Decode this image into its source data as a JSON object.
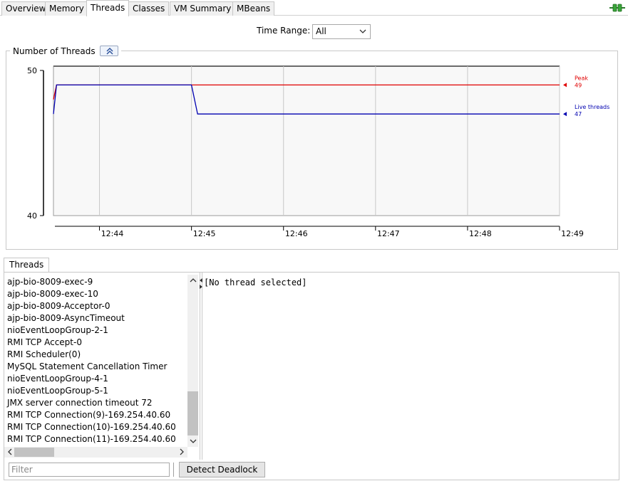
{
  "tabs": [
    {
      "label": "Overview"
    },
    {
      "label": "Memory"
    },
    {
      "label": "Threads",
      "active": true
    },
    {
      "label": "Classes"
    },
    {
      "label": "VM Summary"
    },
    {
      "label": "MBeans"
    }
  ],
  "icons": {
    "connection": "connection-plug-icon",
    "collapse": "collapse-up-icon",
    "dropdown": "chevron-down-icon"
  },
  "time_range": {
    "label": "Time Range:",
    "selected": "All"
  },
  "chart_panel": {
    "title": "Number of Threads"
  },
  "chart_data": {
    "type": "line",
    "ylim": [
      40,
      50
    ],
    "y_ticks": [
      "50",
      "40"
    ],
    "x_ticks": [
      "12:44",
      "12:45",
      "12:46",
      "12:47",
      "12:48",
      "12:49"
    ],
    "series": [
      {
        "name": "Peak",
        "current_value": "49",
        "color": "#e00000",
        "points": [
          [
            "12:43:30",
            48
          ],
          [
            "12:43:32",
            49
          ],
          [
            "12:49:00",
            49
          ]
        ]
      },
      {
        "name": "Live threads",
        "current_value": "47",
        "color": "#0000b0",
        "points": [
          [
            "12:43:30",
            47
          ],
          [
            "12:43:32",
            49
          ],
          [
            "12:45:00",
            49
          ],
          [
            "12:45:04",
            47
          ],
          [
            "12:49:00",
            47
          ]
        ]
      }
    ]
  },
  "threads_panel": {
    "tab_label": "Threads",
    "items": [
      "ajp-bio-8009-exec-9",
      "ajp-bio-8009-exec-10",
      "ajp-bio-8009-Acceptor-0",
      "ajp-bio-8009-AsyncTimeout",
      "nioEventLoopGroup-2-1",
      "RMI TCP Accept-0",
      "RMI Scheduler(0)",
      "MySQL Statement Cancellation Timer",
      "nioEventLoopGroup-4-1",
      "nioEventLoopGroup-5-1",
      "JMX server connection timeout 72",
      "RMI TCP Connection(9)-169.254.40.60",
      "RMI TCP Connection(10)-169.254.40.60",
      "RMI TCP Connection(11)-169.254.40.60"
    ],
    "detail_text": "[No thread selected]",
    "filter_placeholder": "Filter",
    "filter_value": "",
    "detect_deadlock_label": "Detect Deadlock"
  }
}
